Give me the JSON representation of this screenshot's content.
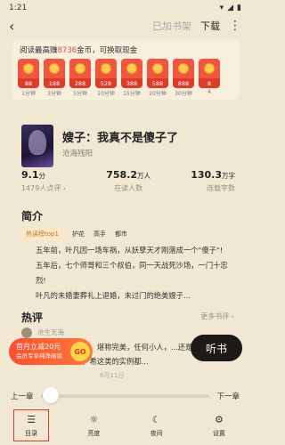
{
  "status": {
    "time": "1:21"
  },
  "topbar": {
    "added_label": "已加书架",
    "download_label": "下载"
  },
  "reward": {
    "title_prefix": "阅读最高赚",
    "title_highlight": "8736",
    "title_suffix": "金币，可换取现金",
    "coins": [
      {
        "value": "88",
        "time": "1分钟"
      },
      {
        "value": "188",
        "time": "3分钟"
      },
      {
        "value": "288",
        "time": "5分钟"
      },
      {
        "value": "528",
        "time": "10分钟"
      },
      {
        "value": "388",
        "time": "15分钟"
      },
      {
        "value": "588",
        "time": "20分钟"
      },
      {
        "value": "888",
        "time": "30分钟"
      },
      {
        "value": "8",
        "time": "4"
      }
    ]
  },
  "book": {
    "title": "嫂子：我真不是傻子了",
    "author": "沧海残阳",
    "rating": "9.1",
    "rating_unit": "分",
    "rating_count": "1479人点评 ›",
    "readers": "758.2",
    "readers_unit": "万人",
    "readers_label": "在读人数",
    "words": "130.3",
    "words_unit": "万字",
    "words_label": "连载字数"
  },
  "intro": {
    "title": "简介",
    "tags": [
      "热读榜top1",
      "护花",
      "高手",
      "都市"
    ],
    "lines": [
      "五年前，叶凡因一场车祸，从妖孽天才刚落成一个\"傻子\"!",
      "五年后，七个师哥和三个叔伯，同一天战死沙场，一门十忠烈!",
      "叶凡的未婚妻葬礼上退婚，未过门的绝美嫂子..."
    ]
  },
  "reviews": {
    "title": "热评",
    "more_label": "更多书评 ›",
    "user": "沧生无海",
    "text": "如此，堪称完美，任何小人，...还是该连根拔起，希这类的实例都...",
    "date": "6月11日"
  },
  "promo": {
    "line1": "首月立减20元",
    "line2": "会员专享纯净阅读",
    "go_label": "GO"
  },
  "listen_label": "听书",
  "chapter": {
    "prev_label": "上一章",
    "next_label": "下一章"
  },
  "nav": [
    {
      "icon": "☰",
      "label": "目录"
    },
    {
      "icon": "☼",
      "label": "亮度"
    },
    {
      "icon": "☾",
      "label": "夜间"
    },
    {
      "icon": "⚙",
      "label": "设置"
    }
  ]
}
